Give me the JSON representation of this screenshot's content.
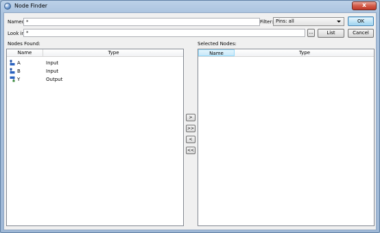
{
  "window": {
    "title": "Node Finder",
    "close_label": "x"
  },
  "form": {
    "named_label": "Named:",
    "named_value": "*",
    "filter_label": "Filter:",
    "filter_value": "Pins: all",
    "lookin_label": "Look in:",
    "lookin_value": "*",
    "browse_label": "...",
    "list_label": "List",
    "ok_label": "OK",
    "cancel_label": "Cancel"
  },
  "found": {
    "label": "Nodes Found:",
    "columns": [
      "Name",
      "Type"
    ],
    "rows": [
      {
        "name": "A",
        "type": "Input",
        "icon": "input-pin-icon"
      },
      {
        "name": "B",
        "type": "Input",
        "icon": "input-pin-icon"
      },
      {
        "name": "Y",
        "type": "Output",
        "icon": "output-pin-icon"
      }
    ]
  },
  "move": {
    "add": ">",
    "add_all": ">>",
    "remove": "<",
    "remove_all": "<<"
  },
  "selected": {
    "label": "Selected Nodes:",
    "columns": [
      "Name",
      "Type"
    ],
    "rows": []
  }
}
